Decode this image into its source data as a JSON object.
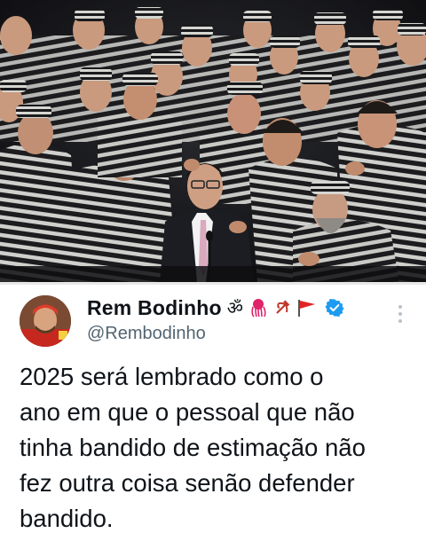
{
  "tweet": {
    "display_name": "Rem Bodinho",
    "name_emojis": [
      "ॐ",
      "🦑",
      "☭",
      "🚩"
    ],
    "handle": "@Rembodinho",
    "text": "2025 será lembrado como o\nano em que o pessoal que não\ntinha bandido de estimação não\nfez outra coisa senão defender\nbandido.",
    "verified_color": "#1d9bf0"
  },
  "photo": {
    "stripe_dark": "#1c1c1f",
    "stripe_light": "#cfd0cc",
    "suit_color": "#1b1d22",
    "tie_color": "#d9a9bd"
  }
}
